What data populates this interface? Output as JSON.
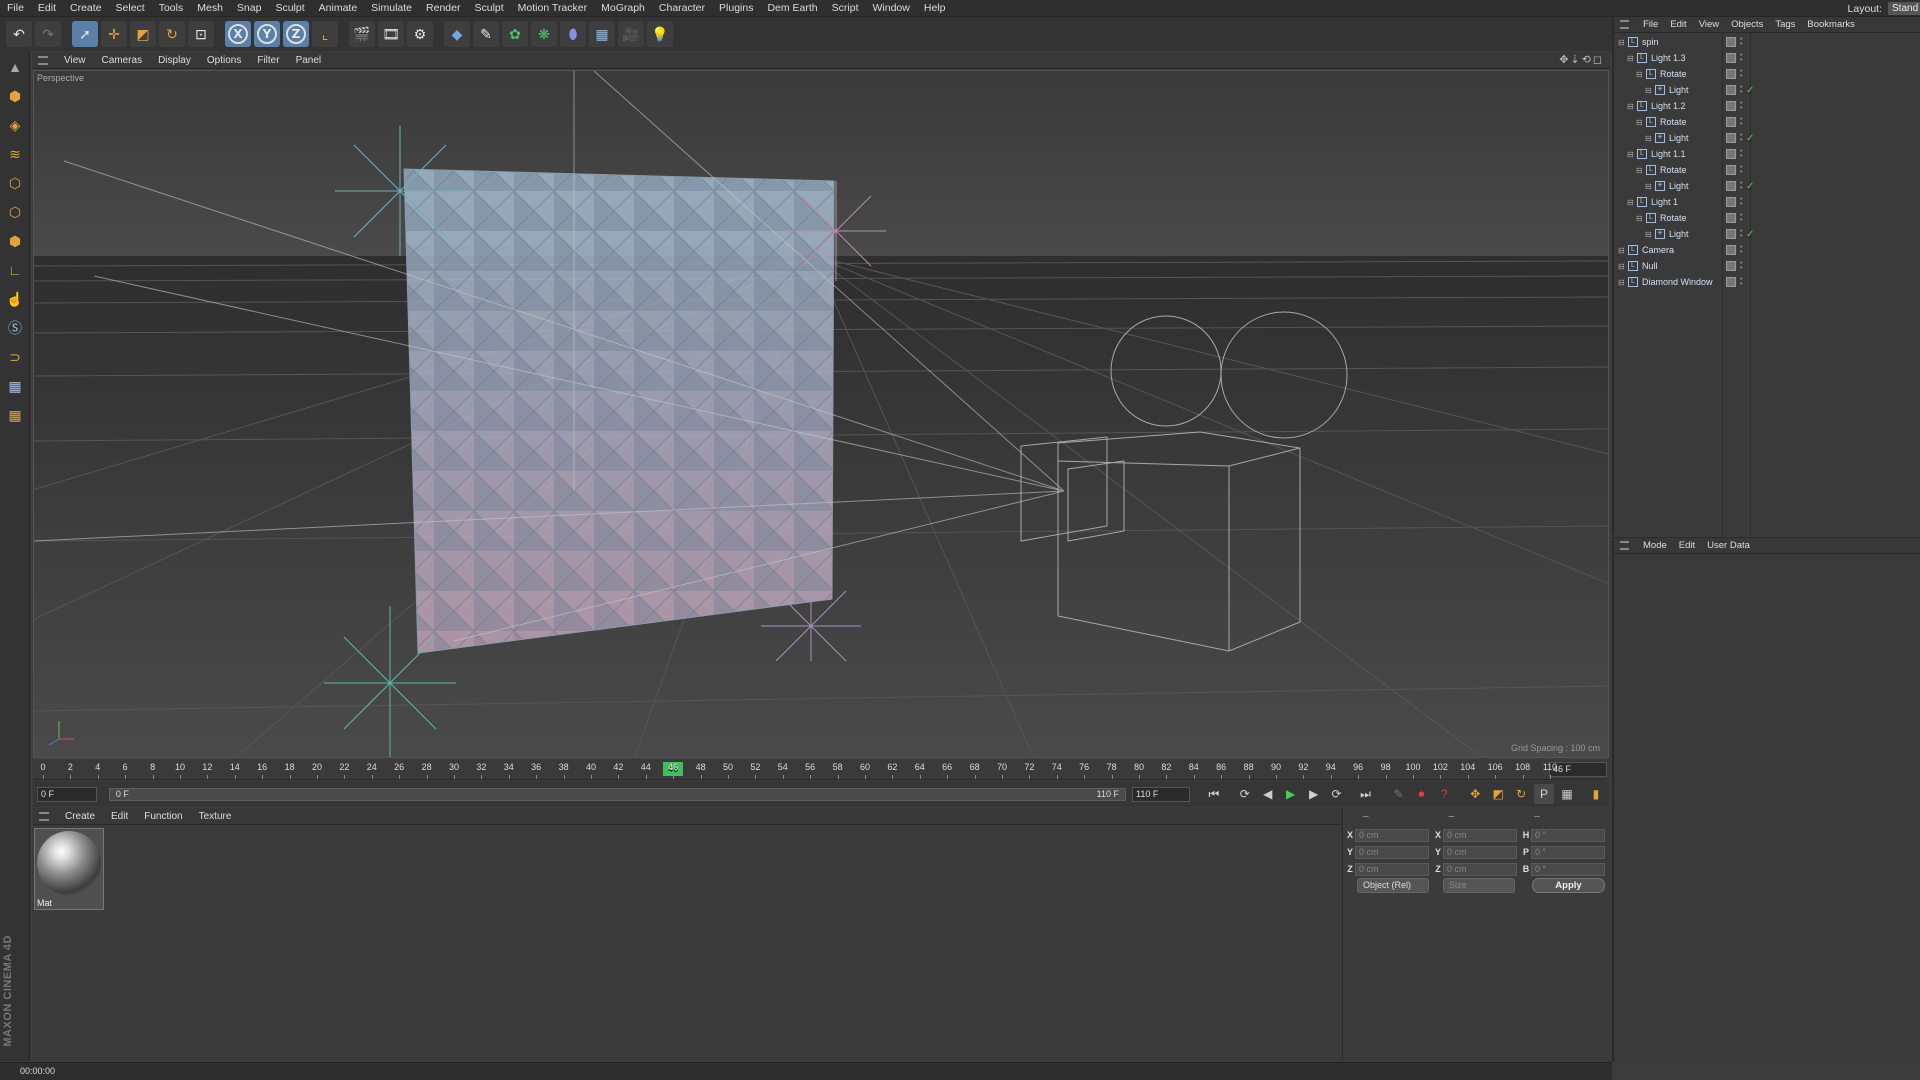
{
  "menubar": {
    "items": [
      "File",
      "Edit",
      "Create",
      "Select",
      "Tools",
      "Mesh",
      "Snap",
      "Sculpt",
      "Animate",
      "Simulate",
      "Render",
      "Sculpt",
      "Motion Tracker",
      "MoGraph",
      "Character",
      "Plugins",
      "Dem Earth",
      "Script",
      "Window",
      "Help"
    ],
    "layout_label": "Layout:",
    "layout_value": "Stand"
  },
  "toolbar": {
    "icons": [
      "undo-icon",
      "redo-icon",
      "live-selection-icon",
      "move-icon",
      "scale-icon",
      "rotate-icon",
      "recent-tool-icon",
      "x-axis-icon",
      "y-axis-icon",
      "z-axis-icon",
      "coordinate-system-icon",
      "render-view-icon",
      "render-picture-viewer-icon",
      "edit-render-settings-icon",
      "cube-icon",
      "spline-pen-icon",
      "subdivision-icon",
      "array-icon",
      "deformer-icon",
      "floor-icon",
      "camera-icon",
      "light-icon"
    ],
    "axis_labels": [
      "X",
      "Y",
      "Z"
    ]
  },
  "viewport": {
    "menu": [
      "View",
      "Cameras",
      "Display",
      "Options",
      "Filter",
      "Panel"
    ],
    "label": "Perspective",
    "grid_spacing": "Grid Spacing : 100 cm"
  },
  "timeline": {
    "ticks": [
      "0",
      "2",
      "4",
      "6",
      "8",
      "10",
      "12",
      "14",
      "16",
      "18",
      "20",
      "22",
      "24",
      "26",
      "28",
      "30",
      "32",
      "34",
      "36",
      "38",
      "40",
      "42",
      "44",
      "46",
      "48",
      "50",
      "52",
      "54",
      "56",
      "58",
      "60",
      "62",
      "64",
      "66",
      "68",
      "70",
      "72",
      "74",
      "76",
      "78",
      "80",
      "82",
      "84",
      "86",
      "88",
      "90",
      "92",
      "94",
      "96",
      "98",
      "100",
      "102",
      "104",
      "106",
      "108",
      "110"
    ],
    "current_frame_label": "46",
    "current_frame_field": "46 F"
  },
  "transport": {
    "start_field": "0 F",
    "range_start": "0 F",
    "range_end": "110 F",
    "end_field": "110 F"
  },
  "materials": {
    "menu": [
      "Create",
      "Edit",
      "Function",
      "Texture"
    ],
    "items": [
      {
        "name": "Mat"
      }
    ]
  },
  "coordinates": {
    "header": [
      "–",
      "–",
      "–"
    ],
    "rows": [
      {
        "a": "X",
        "av": "0 cm",
        "b": "X",
        "bv": "0 cm",
        "c": "H",
        "cv": "0 °"
      },
      {
        "a": "Y",
        "av": "0 cm",
        "b": "Y",
        "bv": "0 cm",
        "c": "P",
        "cv": "0 °"
      },
      {
        "a": "Z",
        "av": "0 cm",
        "b": "Z",
        "bv": "0 cm",
        "c": "B",
        "cv": "0 °"
      }
    ],
    "mode_select": "Object (Rel)",
    "size_select": "Size",
    "apply_label": "Apply"
  },
  "status": {
    "time": "00:00:00"
  },
  "object_manager": {
    "menu": [
      "File",
      "Edit",
      "View",
      "Objects",
      "Tags",
      "Bookmarks"
    ],
    "objects": [
      {
        "name": "spin",
        "level": 0,
        "check": false
      },
      {
        "name": "Light 1.3",
        "level": 1,
        "check": false
      },
      {
        "name": "Rotate",
        "level": 2,
        "check": false
      },
      {
        "name": "Light",
        "level": 3,
        "check": true
      },
      {
        "name": "Light 1.2",
        "level": 1,
        "check": false
      },
      {
        "name": "Rotate",
        "level": 2,
        "check": false
      },
      {
        "name": "Light",
        "level": 3,
        "check": true
      },
      {
        "name": "Light 1.1",
        "level": 1,
        "check": false
      },
      {
        "name": "Rotate",
        "level": 2,
        "check": false
      },
      {
        "name": "Light",
        "level": 3,
        "check": true
      },
      {
        "name": "Light 1",
        "level": 1,
        "check": false
      },
      {
        "name": "Rotate",
        "level": 2,
        "check": false
      },
      {
        "name": "Light",
        "level": 3,
        "check": true
      },
      {
        "name": "Camera",
        "level": 0,
        "check": false
      },
      {
        "name": "Null",
        "level": 0,
        "check": false
      },
      {
        "name": "Diamond Window",
        "level": 0,
        "check": false
      }
    ]
  },
  "attribute_manager": {
    "menu": [
      "Mode",
      "Edit",
      "User Data"
    ]
  },
  "branding": {
    "text": "MAXON CINEMA 4D"
  }
}
